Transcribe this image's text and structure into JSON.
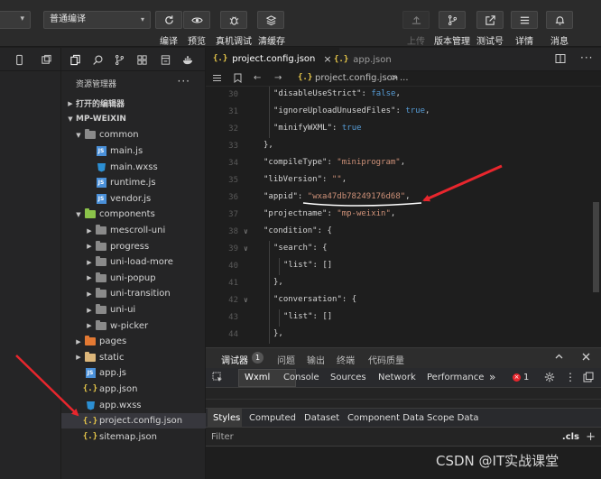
{
  "toolbar": {
    "mode_select": "普通编译",
    "mode_caret": "▾",
    "buttons": [
      {
        "label": "编译",
        "icon": "refresh-icon"
      },
      {
        "label": "预览",
        "icon": "eye-icon"
      },
      {
        "label": "真机调试",
        "icon": "bug-icon"
      },
      {
        "label": "清缓存",
        "icon": "layers-icon"
      }
    ],
    "right_buttons": [
      {
        "label": "上传",
        "icon": "upload-icon"
      },
      {
        "label": "版本管理",
        "icon": "branch-icon"
      },
      {
        "label": "测试号",
        "icon": "external-link-icon"
      },
      {
        "label": "详情",
        "icon": "menu-icon"
      },
      {
        "label": "消息",
        "icon": "bell-icon"
      }
    ]
  },
  "explorer": {
    "title": "资源管理器",
    "more": "···",
    "open_editors": "打开的编辑器",
    "project": "MP-WEIXIN",
    "tree": [
      {
        "label": "common",
        "type": "folder",
        "color": "grey",
        "depth": 1,
        "open": true
      },
      {
        "label": "main.js",
        "type": "js",
        "depth": 2
      },
      {
        "label": "main.wxss",
        "type": "wxss",
        "depth": 2
      },
      {
        "label": "runtime.js",
        "type": "js",
        "depth": 2
      },
      {
        "label": "vendor.js",
        "type": "js",
        "depth": 2
      },
      {
        "label": "components",
        "type": "folder",
        "color": "green",
        "depth": 1,
        "open": true
      },
      {
        "label": "mescroll-uni",
        "type": "folder",
        "color": "grey",
        "depth": 2,
        "open": false
      },
      {
        "label": "progress",
        "type": "folder",
        "color": "grey",
        "depth": 2,
        "open": false
      },
      {
        "label": "uni-load-more",
        "type": "folder",
        "color": "grey",
        "depth": 2,
        "open": false
      },
      {
        "label": "uni-popup",
        "type": "folder",
        "color": "grey",
        "depth": 2,
        "open": false
      },
      {
        "label": "uni-transition",
        "type": "folder",
        "color": "grey",
        "depth": 2,
        "open": false
      },
      {
        "label": "uni-ui",
        "type": "folder",
        "color": "grey",
        "depth": 2,
        "open": false
      },
      {
        "label": "w-picker",
        "type": "folder",
        "color": "grey",
        "depth": 2,
        "open": false
      },
      {
        "label": "pages",
        "type": "folder",
        "color": "orange",
        "depth": 1,
        "open": false
      },
      {
        "label": "static",
        "type": "folder",
        "color": "yellow",
        "depth": 1,
        "open": false
      },
      {
        "label": "app.js",
        "type": "js",
        "depth": 1
      },
      {
        "label": "app.json",
        "type": "json",
        "depth": 1
      },
      {
        "label": "app.wxss",
        "type": "wxss",
        "depth": 1
      },
      {
        "label": "project.config.json",
        "type": "json",
        "depth": 1,
        "selected": true
      },
      {
        "label": "sitemap.json",
        "type": "json",
        "depth": 1
      }
    ]
  },
  "editor": {
    "tabs": [
      {
        "label": "project.config.json",
        "active": true,
        "icon": "{.}",
        "close": "×"
      },
      {
        "label": "app.json",
        "active": false,
        "icon": "{.}"
      }
    ],
    "breadcrumb": {
      "file": "project.config.json",
      "sep": ">",
      "rest": "..."
    },
    "lines": [
      {
        "n": "30",
        "fold": "",
        "indent": 2,
        "tokens": [
          [
            "k",
            "\"disableUseStrict\": "
          ],
          [
            "b",
            "false"
          ],
          [
            "k",
            ","
          ]
        ]
      },
      {
        "n": "31",
        "fold": "",
        "indent": 2,
        "tokens": [
          [
            "k",
            "\"ignoreUploadUnusedFiles\": "
          ],
          [
            "b",
            "true"
          ],
          [
            "k",
            ","
          ]
        ]
      },
      {
        "n": "32",
        "fold": "",
        "indent": 2,
        "tokens": [
          [
            "k",
            "\"minifyWXML\": "
          ],
          [
            "b",
            "true"
          ]
        ]
      },
      {
        "n": "33",
        "fold": "",
        "indent": 1,
        "tokens": [
          [
            "k",
            "},"
          ]
        ]
      },
      {
        "n": "34",
        "fold": "",
        "indent": 1,
        "tokens": [
          [
            "k",
            "\"compileType\": "
          ],
          [
            "s",
            "\"miniprogram\""
          ],
          [
            "k",
            ","
          ]
        ]
      },
      {
        "n": "35",
        "fold": "",
        "indent": 1,
        "tokens": [
          [
            "k",
            "\"libVersion\": "
          ],
          [
            "s",
            "\"\""
          ],
          [
            "k",
            ","
          ]
        ]
      },
      {
        "n": "36",
        "fold": "",
        "indent": 1,
        "tokens": [
          [
            "k",
            "\"appid\": "
          ],
          [
            "s",
            "\"wxa47db78249176d68\""
          ],
          [
            "k",
            ","
          ]
        ]
      },
      {
        "n": "37",
        "fold": "",
        "indent": 1,
        "tokens": [
          [
            "k",
            "\"projectname\": "
          ],
          [
            "s",
            "\"mp-weixin\""
          ],
          [
            "k",
            ","
          ]
        ]
      },
      {
        "n": "38",
        "fold": "∨",
        "indent": 1,
        "tokens": [
          [
            "k",
            "\"condition\": {"
          ]
        ]
      },
      {
        "n": "39",
        "fold": "∨",
        "indent": 2,
        "tokens": [
          [
            "k",
            "\"search\": {"
          ]
        ]
      },
      {
        "n": "40",
        "fold": "",
        "indent": 3,
        "tokens": [
          [
            "k",
            "\"list\": []"
          ]
        ]
      },
      {
        "n": "41",
        "fold": "",
        "indent": 2,
        "tokens": [
          [
            "k",
            "},"
          ]
        ]
      },
      {
        "n": "42",
        "fold": "∨",
        "indent": 2,
        "tokens": [
          [
            "k",
            "\"conversation\": {"
          ]
        ]
      },
      {
        "n": "43",
        "fold": "",
        "indent": 3,
        "tokens": [
          [
            "k",
            "\"list\": []"
          ]
        ]
      },
      {
        "n": "44",
        "fold": "",
        "indent": 2,
        "tokens": [
          [
            "k",
            "},"
          ]
        ]
      }
    ]
  },
  "devtools": {
    "tabs": [
      {
        "label": "调试器",
        "active": true
      },
      {
        "label": "问题"
      },
      {
        "label": "输出"
      },
      {
        "label": "终端"
      },
      {
        "label": "代码质量"
      }
    ],
    "badge": "1",
    "panel_tabs": [
      "Wxml",
      "Console",
      "Sources",
      "Network",
      "Performance"
    ],
    "more": "»",
    "error_count": "1",
    "styles_tabs": [
      "Styles",
      "Computed",
      "Dataset",
      "Component Data",
      "Scope Data"
    ],
    "filter_placeholder": "Filter",
    "cls": ".cls",
    "plus": "+"
  },
  "watermark": "CSDN @IT实战课堂",
  "colors": {
    "annotation_red": "#e8262d",
    "string": "#ce9178",
    "keyword": "#569cd6",
    "folder_green": "#8bc34a",
    "folder_orange": "#e37933",
    "folder_yellow": "#dcb67a"
  }
}
